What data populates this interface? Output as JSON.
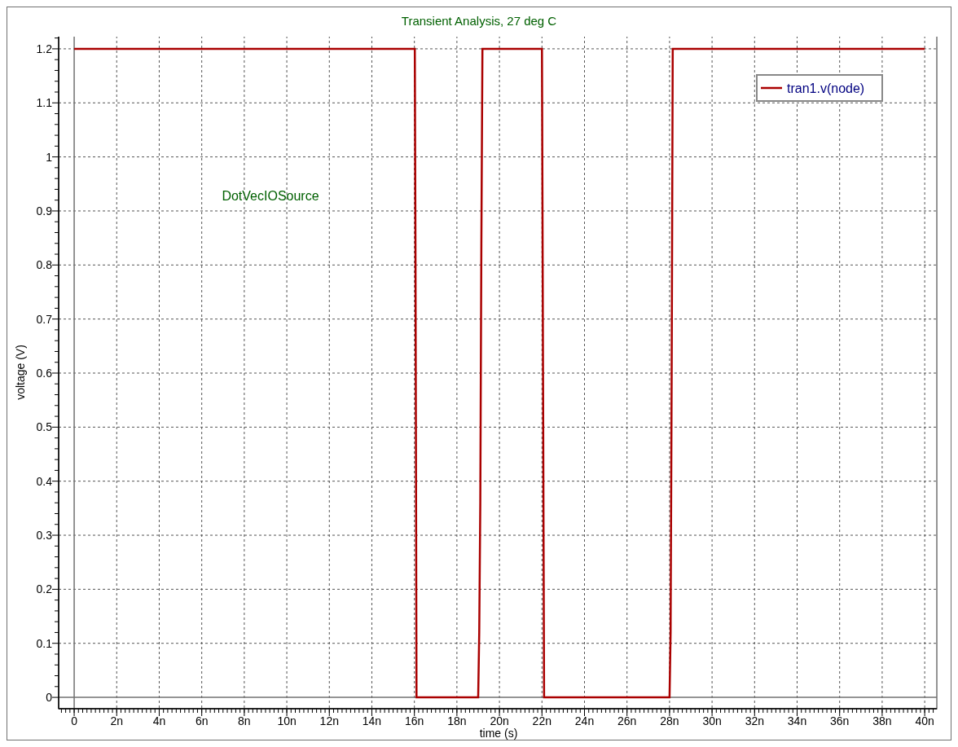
{
  "plot": {
    "chart_data": {
      "type": "line",
      "title": "Transient Analysis, 27 deg C",
      "xlabel": "time (s)",
      "ylabel": "voltage (V)",
      "x": [
        0,
        16,
        16.02,
        16.05,
        16.08,
        16.1,
        19,
        19.05,
        19.1,
        19.15,
        19.2,
        22,
        22.05,
        22.1,
        28,
        28.05,
        28.1,
        28.15,
        40
      ],
      "series": [
        {
          "name": "tran1.v(node)",
          "color": "#aa0000",
          "values": [
            1.2,
            1.2,
            1.2,
            0.84,
            0.36,
            0,
            0,
            0.12,
            0.36,
            0.84,
            1.2,
            1.2,
            0.6,
            0,
            0,
            0.12,
            0.6,
            1.2,
            1.2
          ]
        }
      ],
      "xlim": [
        -0.73,
        40.57
      ],
      "ylim": [
        -0.021,
        1.224
      ],
      "xticks": [
        {
          "value": 0,
          "label": "0"
        },
        {
          "value": 2,
          "label": "2n"
        },
        {
          "value": 4,
          "label": "4n"
        },
        {
          "value": 6,
          "label": "6n"
        },
        {
          "value": 8,
          "label": "8n"
        },
        {
          "value": 10,
          "label": "10n"
        },
        {
          "value": 12,
          "label": "12n"
        },
        {
          "value": 14,
          "label": "14n"
        },
        {
          "value": 16,
          "label": "16n"
        },
        {
          "value": 18,
          "label": "18n"
        },
        {
          "value": 20,
          "label": "20n"
        },
        {
          "value": 22,
          "label": "22n"
        },
        {
          "value": 24,
          "label": "24n"
        },
        {
          "value": 26,
          "label": "26n"
        },
        {
          "value": 28,
          "label": "28n"
        },
        {
          "value": 30,
          "label": "30n"
        },
        {
          "value": 32,
          "label": "32n"
        },
        {
          "value": 34,
          "label": "34n"
        },
        {
          "value": 36,
          "label": "36n"
        },
        {
          "value": 38,
          "label": "38n"
        },
        {
          "value": 40,
          "label": "40n"
        }
      ],
      "yticks": [
        {
          "value": 0,
          "label": "0"
        },
        {
          "value": 0.1,
          "label": "0.1"
        },
        {
          "value": 0.2,
          "label": "0.2"
        },
        {
          "value": 0.3,
          "label": "0.3"
        },
        {
          "value": 0.4,
          "label": "0.4"
        },
        {
          "value": 0.5,
          "label": "0.5"
        },
        {
          "value": 0.6,
          "label": "0.6"
        },
        {
          "value": 0.7,
          "label": "0.7"
        },
        {
          "value": 0.8,
          "label": "0.8"
        },
        {
          "value": 0.9,
          "label": "0.9"
        },
        {
          "value": 1,
          "label": "1"
        },
        {
          "value": 1.1,
          "label": "1.1"
        },
        {
          "value": 1.2,
          "label": "1.2"
        }
      ],
      "grid": true,
      "annotations": [
        "DotVecIOSource"
      ]
    }
  }
}
